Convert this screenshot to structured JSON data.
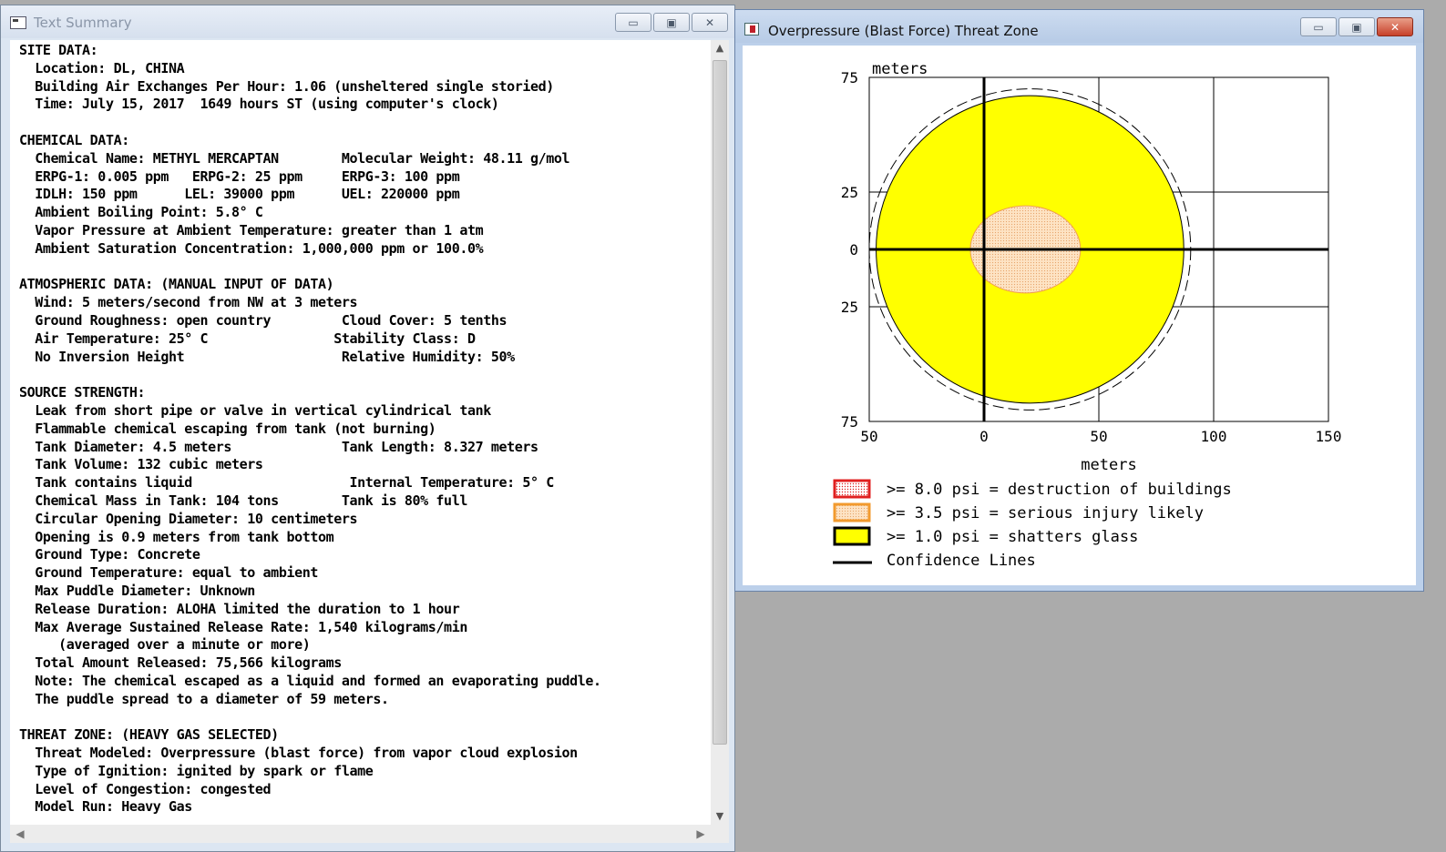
{
  "text_window": {
    "title": "Text Summary",
    "lines": [
      "SITE DATA:",
      "  Location: DL, CHINA",
      "  Building Air Exchanges Per Hour: 1.06 (unsheltered single storied)",
      "  Time: July 15, 2017  1649 hours ST (using computer's clock)",
      "",
      "CHEMICAL DATA:",
      "  Chemical Name: METHYL MERCAPTAN        Molecular Weight: 48.11 g/mol",
      "  ERPG-1: 0.005 ppm   ERPG-2: 25 ppm     ERPG-3: 100 ppm",
      "  IDLH: 150 ppm      LEL: 39000 ppm      UEL: 220000 ppm",
      "  Ambient Boiling Point: 5.8° C",
      "  Vapor Pressure at Ambient Temperature: greater than 1 atm",
      "  Ambient Saturation Concentration: 1,000,000 ppm or 100.0%",
      "",
      "ATMOSPHERIC DATA: (MANUAL INPUT OF DATA)",
      "  Wind: 5 meters/second from NW at 3 meters",
      "  Ground Roughness: open country         Cloud Cover: 5 tenths",
      "  Air Temperature: 25° C                Stability Class: D",
      "  No Inversion Height                    Relative Humidity: 50%",
      "",
      "SOURCE STRENGTH:",
      "  Leak from short pipe or valve in vertical cylindrical tank",
      "  Flammable chemical escaping from tank (not burning)",
      "  Tank Diameter: 4.5 meters              Tank Length: 8.327 meters",
      "  Tank Volume: 132 cubic meters",
      "  Tank contains liquid                    Internal Temperature: 5° C",
      "  Chemical Mass in Tank: 104 tons        Tank is 80% full",
      "  Circular Opening Diameter: 10 centimeters",
      "  Opening is 0.9 meters from tank bottom",
      "  Ground Type: Concrete",
      "  Ground Temperature: equal to ambient",
      "  Max Puddle Diameter: Unknown",
      "  Release Duration: ALOHA limited the duration to 1 hour",
      "  Max Average Sustained Release Rate: 1,540 kilograms/min",
      "     (averaged over a minute or more)",
      "  Total Amount Released: 75,566 kilograms",
      "  Note: The chemical escaped as a liquid and formed an evaporating puddle.",
      "  The puddle spread to a diameter of 59 meters.",
      "",
      "THREAT ZONE: (HEAVY GAS SELECTED)",
      "  Threat Modeled: Overpressure (blast force) from vapor cloud explosion",
      "  Type of Ignition: ignited by spark or flame",
      "  Level of Congestion: congested",
      "  Model Run: Heavy Gas"
    ]
  },
  "plot_window": {
    "title": "Overpressure (Blast Force) Threat Zone",
    "y_axis_label": "meters",
    "x_axis_label": "meters",
    "y_ticks": [
      "75",
      "25",
      "0",
      "25",
      "75"
    ],
    "x_ticks": [
      "50",
      "0",
      "50",
      "100",
      "150"
    ],
    "legend": [
      {
        "label": ">= 8.0 psi = destruction of buildings",
        "color": "#e02020",
        "fill": "#fce6e6"
      },
      {
        "label": ">= 3.5 psi = serious injury likely",
        "color": "#f29a2e",
        "fill": "#fbd9b3"
      },
      {
        "label": ">= 1.0 psi = shatters glass",
        "color": "#000000",
        "fill": "#ffff00"
      },
      {
        "label": "Confidence Lines",
        "color": "#000000"
      }
    ]
  },
  "chart_data": {
    "type": "threat_zone",
    "xlabel": "meters",
    "ylabel": "meters",
    "xlim": [
      -50,
      150
    ],
    "ylim": [
      -75,
      75
    ],
    "x_tick_values": [
      -50,
      0,
      50,
      100,
      150
    ],
    "y_tick_values": [
      75,
      25,
      0,
      -25,
      -75
    ],
    "zones": [
      {
        "name": ">= 1.0 psi = shatters glass",
        "center": [
          20,
          0
        ],
        "radius": 67,
        "color": "#ffff00"
      },
      {
        "name": ">= 3.5 psi = serious injury likely",
        "center": [
          18,
          0
        ],
        "radius_x": 24,
        "radius_y": 19,
        "color": "#fbd9b3"
      }
    ],
    "confidence_line_radius": 70,
    "grid": true
  }
}
